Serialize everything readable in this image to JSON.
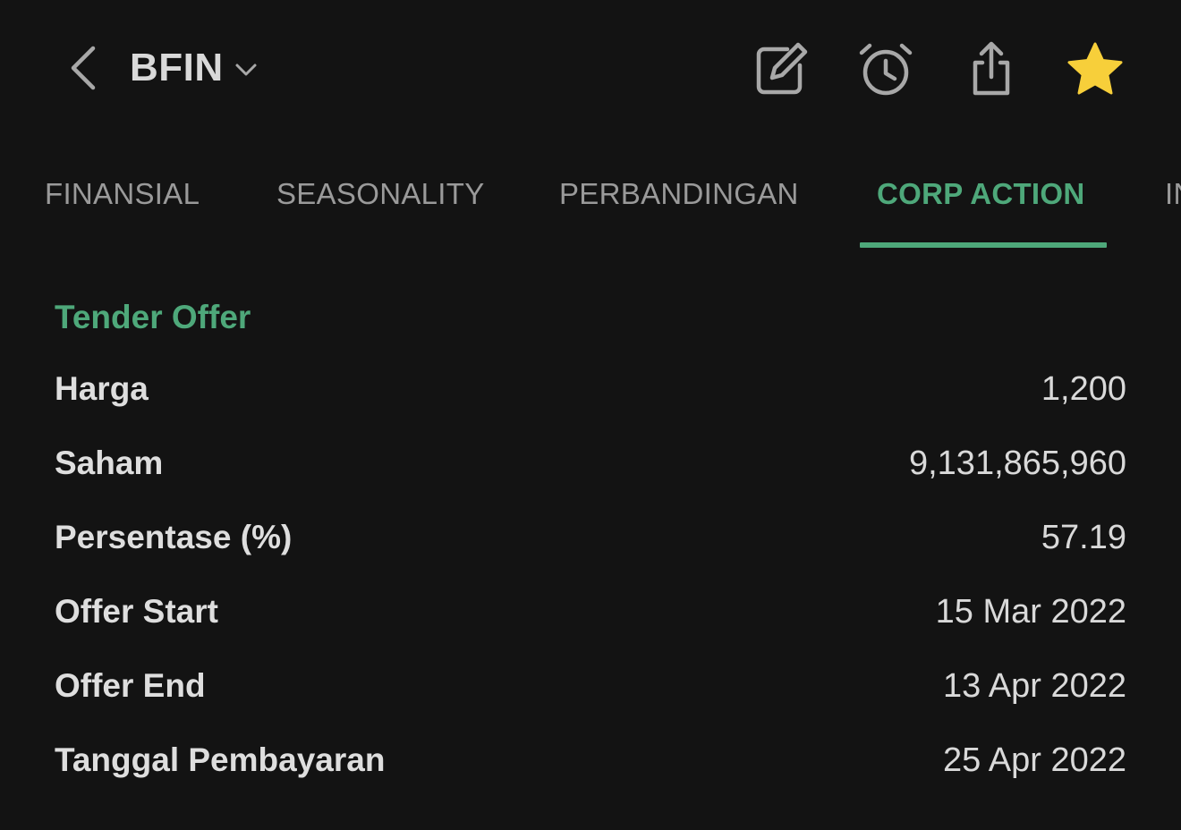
{
  "header": {
    "back_icon": "chevron-left-icon",
    "ticker": "BFIN",
    "ticker_dropdown_icon": "chevron-down-icon",
    "actions": [
      {
        "name": "edit-note-icon"
      },
      {
        "name": "alarm-icon"
      },
      {
        "name": "share-icon"
      },
      {
        "name": "star-icon",
        "color": "#f7cf3a"
      }
    ]
  },
  "tabs": [
    {
      "label": "FINANSIAL",
      "active": false
    },
    {
      "label": "SEASONALITY",
      "active": false
    },
    {
      "label": "PERBANDINGAN",
      "active": false
    },
    {
      "label": "CORP ACTION",
      "active": true
    },
    {
      "label": "IN",
      "active": false
    }
  ],
  "section": {
    "title": "Tender Offer",
    "rows": [
      {
        "label": "Harga",
        "value": "1,200"
      },
      {
        "label": "Saham",
        "value": "9,131,865,960"
      },
      {
        "label": "Persentase (%)",
        "value": "57.19"
      },
      {
        "label": "Offer Start",
        "value": "15 Mar 2022"
      },
      {
        "label": "Offer End",
        "value": "13 Apr 2022"
      },
      {
        "label": "Tanggal Pembayaran",
        "value": "25 Apr 2022"
      }
    ]
  },
  "colors": {
    "background": "#131313",
    "accent": "#4ea87a",
    "star": "#f7cf3a",
    "text": "#dedede",
    "muted": "#9a9a9a"
  }
}
